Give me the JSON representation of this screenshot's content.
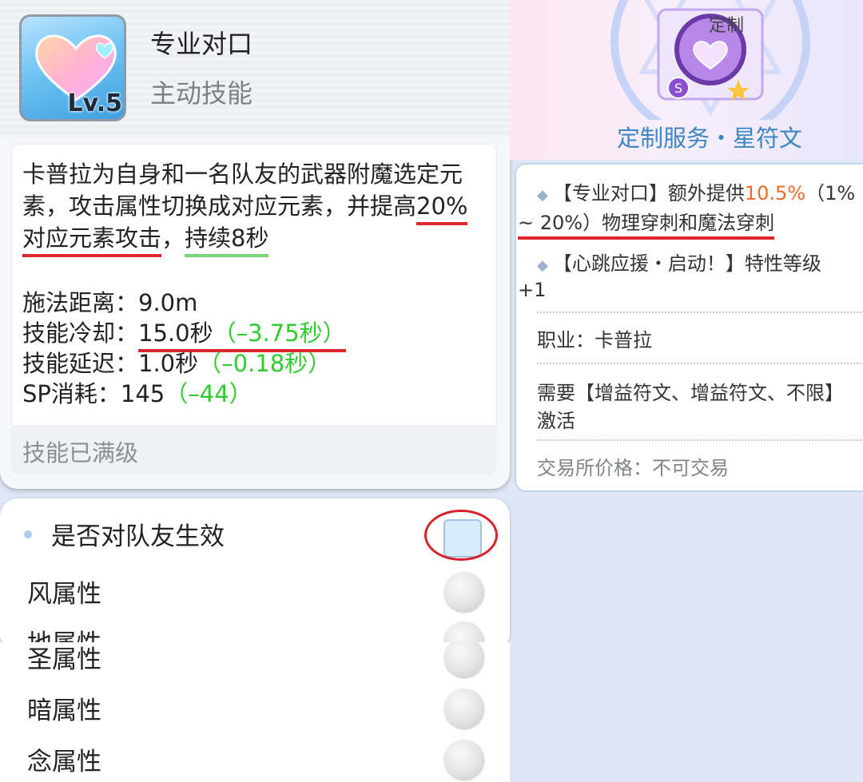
{
  "skill": {
    "name": "专业对口",
    "type": "主动技能",
    "level": "Lv.5",
    "description_part1": "卡普拉为自身和一名队友的武器附魔选定元素，攻击属性切换成对应元素，并提高",
    "description_buff": "20%对应元素攻击",
    "description_sep": "，",
    "description_duration": "持续8秒",
    "stats": {
      "range_label": "施法距离：",
      "range_value": "9.0m",
      "cooldown_label": "技能冷却：",
      "cooldown_value": "15.0秒",
      "cooldown_delta": "（–3.75秒）",
      "delay_label": "技能延迟：",
      "delay_value": "1.0秒",
      "delay_delta": "（–0.18秒）",
      "sp_label": "SP消耗：",
      "sp_value": "145",
      "sp_delta": "（–44）"
    },
    "max_level_text": "技能已满级"
  },
  "options": {
    "apply_to_teammate": "是否对队友生效",
    "items": [
      "风属性",
      "地属性",
      "圣属性",
      "暗属性",
      "念属性"
    ]
  },
  "rune": {
    "tag": "定制",
    "title": "定制服务・星符文",
    "effect1_a": "【专业对口】额外提供",
    "effect1_pct": "10.5%",
    "effect1_b": "（1%",
    "effect1_c": "~ 20%）物理穿刺和魔法穿刺",
    "effect2_a": "【心跳应援・启动！】特性等级",
    "effect2_b": "+1",
    "job": "职业：卡普拉",
    "require_a": "需要【增益符文、增益符文、不限】",
    "require_b": "激活",
    "trade": "交易所价格：不可交易"
  },
  "colors": {
    "accent_blue": "#3d86c6",
    "delta_green": "#2fcc2f",
    "highlight_orange": "#f06a2a",
    "annotation_red": "#e0242c",
    "annotation_green": "#7ad67a"
  }
}
